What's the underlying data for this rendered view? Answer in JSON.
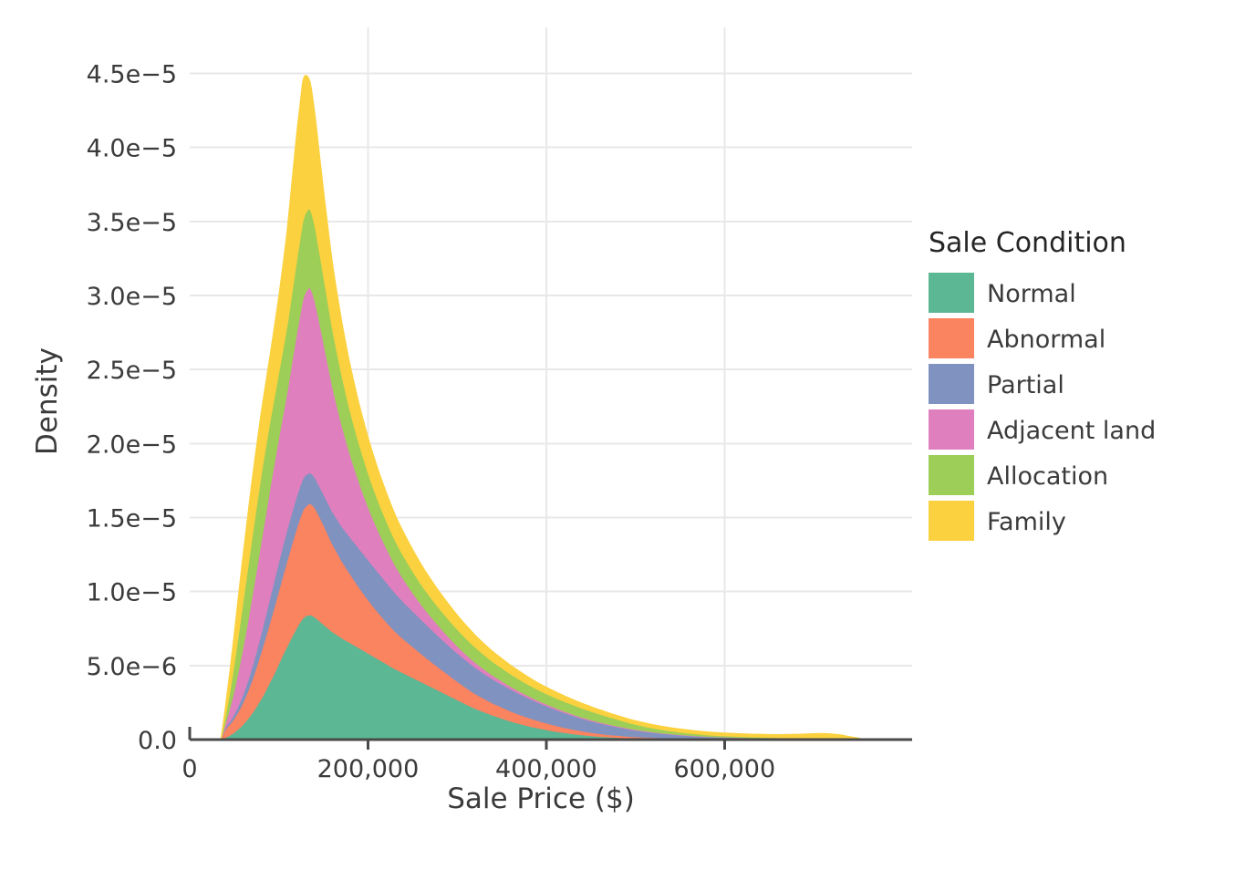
{
  "chart_data": {
    "type": "area",
    "variant": "stacked-density",
    "title": "",
    "xlabel": "Sale Price ($)",
    "ylabel": "Density",
    "xlim": [
      0,
      790000
    ],
    "ylim": [
      0,
      4.75e-05
    ],
    "xticks": [
      0,
      200000,
      400000,
      600000
    ],
    "xtick_labels": [
      "0",
      "200,000",
      "400,000",
      "600,000"
    ],
    "yticks": [
      0,
      5e-06,
      1e-05,
      1.5e-05,
      2e-05,
      2.5e-05,
      3e-05,
      3.5e-05,
      4e-05,
      4.5e-05
    ],
    "ytick_labels": [
      "0.0",
      "5.0e−6",
      "1.0e−5",
      "1.5e−5",
      "2.0e−5",
      "2.5e−5",
      "3.0e−5",
      "3.5e−5",
      "4.0e−5",
      "4.5e−5"
    ],
    "grid": true,
    "grid_color": "#e8e8e8",
    "legend": {
      "title": "Sale Condition",
      "position": "right",
      "entries": [
        {
          "label": "Normal",
          "color": "#5CB795"
        },
        {
          "label": "Abnormal",
          "color": "#FA8360"
        },
        {
          "label": "Partial",
          "color": "#8092C0"
        },
        {
          "label": "Adjacent land",
          "color": "#DF7FBE"
        },
        {
          "label": "Allocation",
          "color": "#9DCE58"
        },
        {
          "label": "Family",
          "color": "#FBD13F"
        }
      ]
    },
    "x": [
      35000,
      40000,
      45000,
      50000,
      55000,
      60000,
      65000,
      70000,
      75000,
      80000,
      85000,
      90000,
      95000,
      100000,
      105000,
      110000,
      115000,
      120000,
      125000,
      127000,
      130000,
      135000,
      140000,
      145000,
      150000,
      155000,
      160000,
      165000,
      170000,
      175000,
      180000,
      190000,
      200000,
      210000,
      220000,
      230000,
      240000,
      250000,
      260000,
      270000,
      280000,
      290000,
      300000,
      310000,
      320000,
      330000,
      340000,
      350000,
      360000,
      370000,
      380000,
      390000,
      400000,
      410000,
      420000,
      430000,
      440000,
      450000,
      460000,
      470000,
      480000,
      490000,
      500000,
      520000,
      540000,
      560000,
      580000,
      600000,
      620000,
      640000,
      660000,
      680000,
      700000,
      710000,
      720000,
      730000,
      740000,
      750000,
      755000
    ],
    "series": [
      {
        "name": "Normal",
        "color": "#5CB795",
        "values": [
          0.0,
          1.5e-07,
          3e-07,
          5e-07,
          7.5e-07,
          1.05e-06,
          1.4e-06,
          1.8e-06,
          2.25e-06,
          2.75e-06,
          3.3e-06,
          3.9e-06,
          4.5e-06,
          5.15e-06,
          5.8e-06,
          6.4e-06,
          7e-06,
          7.55e-06,
          8.05e-06,
          8.2e-06,
          8.35e-06,
          8.42e-06,
          8.3e-06,
          8.05e-06,
          7.8e-06,
          7.55e-06,
          7.3e-06,
          7.1e-06,
          6.9e-06,
          6.72e-06,
          6.55e-06,
          6.2e-06,
          5.85e-06,
          5.5e-06,
          5.15e-06,
          4.8e-06,
          4.5e-06,
          4.2e-06,
          3.9e-06,
          3.6e-06,
          3.3e-06,
          3e-06,
          2.7e-06,
          2.4e-06,
          2.12e-06,
          1.88e-06,
          1.65e-06,
          1.45e-06,
          1.25e-06,
          1.08e-06,
          9.3e-07,
          8e-07,
          6.8e-07,
          5.7e-07,
          4.8e-07,
          4e-07,
          3.3e-07,
          2.7e-07,
          2.2e-07,
          1.8e-07,
          1.5e-07,
          1.2e-07,
          1e-07,
          7e-08,
          5e-08,
          4e-08,
          3e-08,
          2.5e-08,
          2e-08,
          1.5e-08,
          1.2e-08,
          1e-08,
          8e-09,
          8e-09,
          7e-09,
          6e-09,
          5e-09,
          4e-09,
          0.0
        ]
      },
      {
        "name": "Abnormal",
        "color": "#FA8360",
        "values": [
          0.0,
          5.5e-07,
          7.5e-07,
          9.5e-07,
          1.2e-06,
          1.5e-06,
          1.85e-06,
          2.25e-06,
          2.7e-06,
          3.15e-06,
          3.6e-06,
          4.05e-06,
          4.5e-06,
          4.95e-06,
          5.4e-06,
          5.85e-06,
          6.3e-06,
          6.75e-06,
          7.15e-06,
          7.3e-06,
          7.4e-06,
          7.52e-06,
          7.4e-06,
          7.1e-06,
          6.75e-06,
          6.35e-06,
          5.95e-06,
          5.6e-06,
          5.25e-06,
          4.95e-06,
          4.65e-06,
          4.1e-06,
          3.62e-06,
          3.2e-06,
          2.85e-06,
          2.55e-06,
          2.3e-06,
          2.1e-06,
          1.9e-06,
          1.72e-06,
          1.55e-06,
          1.4e-06,
          1.25e-06,
          1.12e-06,
          1e-06,
          9e-07,
          8.2e-07,
          7.5e-07,
          6.8e-07,
          6.2e-07,
          5.6e-07,
          5e-07,
          4.5e-07,
          4e-07,
          3.5e-07,
          3e-07,
          2.6e-07,
          2.2e-07,
          1.9e-07,
          1.6e-07,
          1.4e-07,
          1.2e-07,
          1e-07,
          8e-08,
          6e-08,
          5e-08,
          4e-08,
          3.5e-08,
          3e-08,
          2.5e-08,
          2e-08,
          1.8e-08,
          1.5e-08,
          1.5e-08,
          1.2e-08,
          1e-08,
          8e-09,
          6e-09,
          0.0
        ]
      },
      {
        "name": "Partial",
        "color": "#8092C0",
        "values": [
          0.0,
          1e-07,
          2e-07,
          3e-07,
          4.2e-07,
          5.5e-07,
          7e-07,
          8.8e-07,
          1.05e-06,
          1.25e-06,
          1.45e-06,
          1.65e-06,
          1.82e-06,
          1.95e-06,
          2.05e-06,
          2.12e-06,
          2.15e-06,
          2.16e-06,
          2.15e-06,
          2.14e-06,
          2.12e-06,
          2.08e-06,
          2.05e-06,
          2.05e-06,
          2.08e-06,
          2.12e-06,
          2.18e-06,
          2.25e-06,
          2.32e-06,
          2.4e-06,
          2.48e-06,
          2.62e-06,
          2.7e-06,
          2.72e-06,
          2.68e-06,
          2.6e-06,
          2.5e-06,
          2.4e-06,
          2.3e-06,
          2.2e-06,
          2.1e-06,
          2e-06,
          1.92e-06,
          1.85e-06,
          1.78e-06,
          1.7e-06,
          1.62e-06,
          1.55e-06,
          1.48e-06,
          1.4e-06,
          1.32e-06,
          1.24e-06,
          1.16e-06,
          1.08e-06,
          1e-06,
          9.3e-07,
          8.5e-07,
          7.8e-07,
          7.1e-07,
          6.4e-07,
          5.7e-07,
          5e-07,
          4.4e-07,
          3.3e-07,
          2.5e-07,
          1.8e-07,
          1.3e-07,
          1e-07,
          7.5e-08,
          6e-08,
          5e-08,
          4e-08,
          3.5e-08,
          3e-08,
          2.8e-08,
          2.5e-08,
          2e-08,
          1.5e-08,
          0.0
        ]
      },
      {
        "name": "Adjacent land",
        "color": "#DF7FBE",
        "values": [
          0.0,
          3e-07,
          9e-07,
          1.6e-06,
          2.4e-06,
          3.2e-06,
          4e-06,
          4.8e-06,
          5.5e-06,
          6.2e-06,
          6.8e-06,
          7.4e-06,
          7.9e-06,
          8.4e-06,
          8.85e-06,
          9.4e-06,
          1.02e-05,
          1.1e-05,
          1.18e-05,
          1.21e-05,
          1.235e-05,
          1.25e-05,
          1.2e-05,
          1.12e-05,
          1.03e-05,
          9.4e-06,
          8.5e-06,
          7.7e-06,
          6.95e-06,
          6.25e-06,
          5.6e-06,
          4.5e-06,
          3.6e-06,
          2.9e-06,
          2.35e-06,
          1.9e-06,
          1.55e-06,
          1.25e-06,
          1.02e-06,
          8.4e-07,
          7e-07,
          5.8e-07,
          4.8e-07,
          4e-07,
          3.4e-07,
          2.9e-07,
          2.5e-07,
          2.2e-07,
          1.9e-07,
          1.7e-07,
          1.5e-07,
          1.3e-07,
          1.2e-07,
          1.1e-07,
          1e-07,
          9e-08,
          8e-08,
          7.5e-08,
          7e-08,
          6.5e-08,
          6e-08,
          5.5e-08,
          5e-08,
          4e-08,
          3.5e-08,
          3e-08,
          2.5e-08,
          2e-08,
          1.8e-08,
          1.5e-08,
          1.2e-08,
          1e-08,
          1e-08,
          8e-09,
          8e-09,
          6e-09,
          5e-09,
          4e-09,
          0.0
        ]
      },
      {
        "name": "Allocation",
        "color": "#9DCE58",
        "values": [
          0.0,
          4.5e-07,
          1.1e-06,
          1.8e-06,
          2.5e-06,
          3.1e-06,
          3.6e-06,
          4e-06,
          4.3e-06,
          4.5e-06,
          4.55e-06,
          4.5e-06,
          4.45e-06,
          4.4e-06,
          4.42e-06,
          4.5e-06,
          4.7e-06,
          4.95e-06,
          5.2e-06,
          5.3e-06,
          5.35e-06,
          5.3e-06,
          5.1e-06,
          4.8e-06,
          4.5e-06,
          4.2e-06,
          3.9e-06,
          3.65e-06,
          3.4e-06,
          3.18e-06,
          2.95e-06,
          2.6e-06,
          2.3e-06,
          2.05e-06,
          1.85e-06,
          1.68e-06,
          1.55e-06,
          1.45e-06,
          1.35e-06,
          1.28e-06,
          1.22e-06,
          1.18e-06,
          1.12e-06,
          1.08e-06,
          1.03e-06,
          9.8e-07,
          9.3e-07,
          8.8e-07,
          8.4e-07,
          8e-07,
          7.6e-07,
          7.3e-07,
          7e-07,
          6.8e-07,
          6.6e-07,
          6.4e-07,
          6.1e-07,
          5.8e-07,
          5.4e-07,
          5e-07,
          4.5e-07,
          4e-07,
          3.5e-07,
          2.6e-07,
          1.9e-07,
          1.4e-07,
          1e-07,
          8e-08,
          6e-08,
          5e-08,
          4e-08,
          3.5e-08,
          3e-08,
          3e-08,
          2.5e-08,
          2e-08,
          1.5e-08,
          1e-08,
          0.0
        ]
      },
      {
        "name": "Family",
        "color": "#FBD13F",
        "values": [
          0.0,
          6e-07,
          1.3e-06,
          2e-06,
          2.6e-06,
          3.1e-06,
          3.5e-06,
          3.8e-06,
          4e-06,
          4.15e-06,
          4.25e-06,
          4.4e-06,
          4.7e-06,
          5.1e-06,
          5.7e-06,
          6.5e-06,
          7.5e-06,
          8.5e-06,
          9.2e-06,
          9.45e-06,
          9.3e-06,
          8.6e-06,
          7.6e-06,
          6.6e-06,
          5.7e-06,
          5e-06,
          4.4e-06,
          3.95e-06,
          3.6e-06,
          3.3e-06,
          3.05e-06,
          2.65e-06,
          2.35e-06,
          2.1e-06,
          1.9e-06,
          1.72e-06,
          1.58e-06,
          1.45e-06,
          1.33e-06,
          1.22e-06,
          1.12e-06,
          1.03e-06,
          9.5e-07,
          8.7e-07,
          8e-07,
          7.4e-07,
          6.8e-07,
          6.3e-07,
          5.8e-07,
          5.4e-07,
          5e-07,
          4.6e-07,
          4.3e-07,
          4e-07,
          3.7e-07,
          3.4e-07,
          3.2e-07,
          3e-07,
          2.8e-07,
          2.6e-07,
          2.5e-07,
          2.4e-07,
          2.3e-07,
          2.2e-07,
          2.1e-07,
          2e-07,
          1.9e-07,
          1.8e-07,
          1.8e-07,
          1.9e-07,
          2e-07,
          2.4e-07,
          3e-07,
          3.2e-07,
          3e-07,
          2.5e-07,
          1.5e-07,
          6e-08,
          0.0
        ]
      }
    ]
  }
}
